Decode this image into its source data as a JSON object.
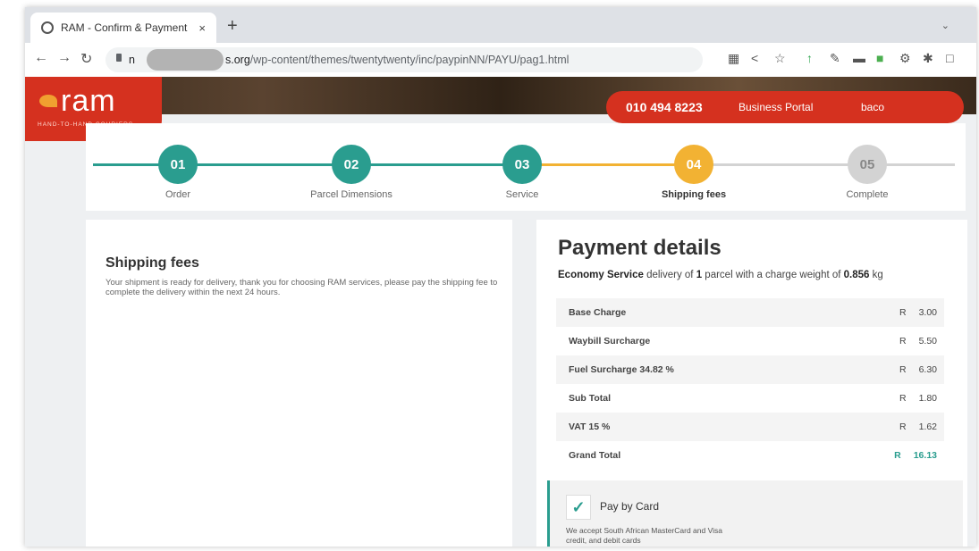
{
  "browser": {
    "tab_title": "RAM - Confirm & Payment",
    "tab_close": "×",
    "new_tab": "+",
    "tab_menu": "⌄",
    "url_prefix": "n",
    "url_domain_suffix": "s.org",
    "url_path": "/wp-content/themes/twentytwenty/inc/paypinNN/PAYU/pag1.html"
  },
  "header": {
    "logo_text": "ram",
    "logo_tagline": "HAND-TO-HAND COURIERS",
    "phone": "010 494 8223",
    "business_portal": "Business Portal",
    "user": "baco"
  },
  "stepper": {
    "steps": [
      {
        "num": "01",
        "label": "Order"
      },
      {
        "num": "02",
        "label": "Parcel Dimensions"
      },
      {
        "num": "03",
        "label": "Service"
      },
      {
        "num": "04",
        "label": "Shipping fees"
      },
      {
        "num": "05",
        "label": "Complete"
      }
    ]
  },
  "shipping": {
    "title": "Shipping fees",
    "message": "Your shipment is ready for delivery, thank you for choosing RAM services, please pay the shipping fee to complete the delivery within the next 24 hours."
  },
  "payment": {
    "title": "Payment details",
    "service_name": "Economy Service",
    "desc_mid": " delivery of ",
    "parcel_count": "1",
    "desc_tail": " parcel with a charge weight of ",
    "weight": "0.856",
    "weight_unit": " kg",
    "currency": "R",
    "rows": [
      {
        "label": "Base Charge",
        "amount": "3.00"
      },
      {
        "label": "Waybill Surcharge",
        "amount": "5.50"
      },
      {
        "label": "Fuel Surcharge 34.82 %",
        "amount": "6.30"
      },
      {
        "label": "Sub Total",
        "amount": "1.80"
      },
      {
        "label": "VAT 15 %",
        "amount": "1.62"
      },
      {
        "label": "Grand Total",
        "amount": "16.13"
      }
    ],
    "pay_by_card": "Pay by Card",
    "card_note": "We accept South African MasterCard and Visa credit, and debit cards"
  },
  "colors": {
    "brand_red": "#d5311f",
    "teal": "#2a9d8f",
    "active_yellow": "#f2b233",
    "inactive_gray": "#d3d3d3"
  }
}
